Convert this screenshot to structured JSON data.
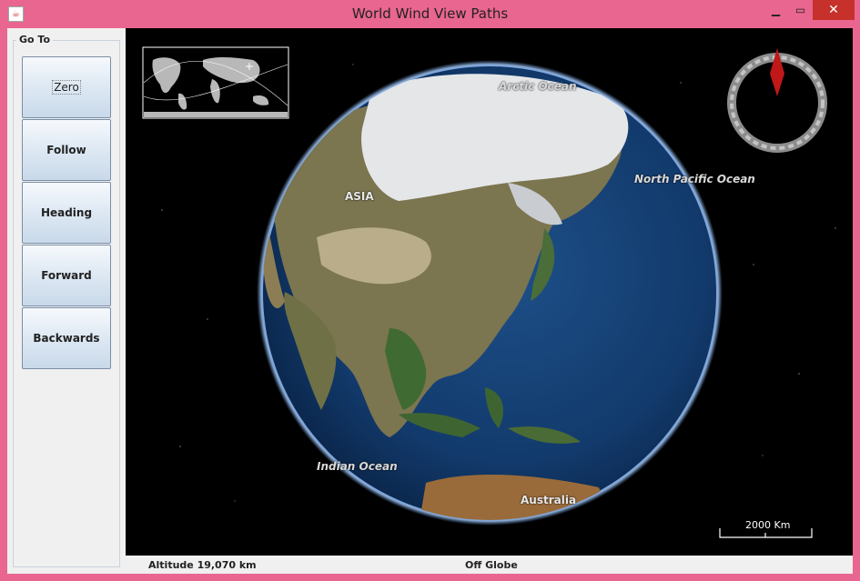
{
  "window": {
    "title": "World Wind View Paths",
    "app_icon": "java-icon"
  },
  "goto_panel": {
    "legend": "Go To",
    "buttons": [
      "Zero",
      "Follow",
      "Heading",
      "Forward",
      "Backwards"
    ]
  },
  "map": {
    "labels": {
      "arctic": "Arctic Ocean",
      "north_pacific": "North Pacific Ocean",
      "asia": "ASIA",
      "indian": "Indian Ocean",
      "australia": "Australia"
    },
    "scale_bar": "2000 Km"
  },
  "status": {
    "altitude": "Altitude  19,070 km",
    "position": "Off Globe"
  }
}
